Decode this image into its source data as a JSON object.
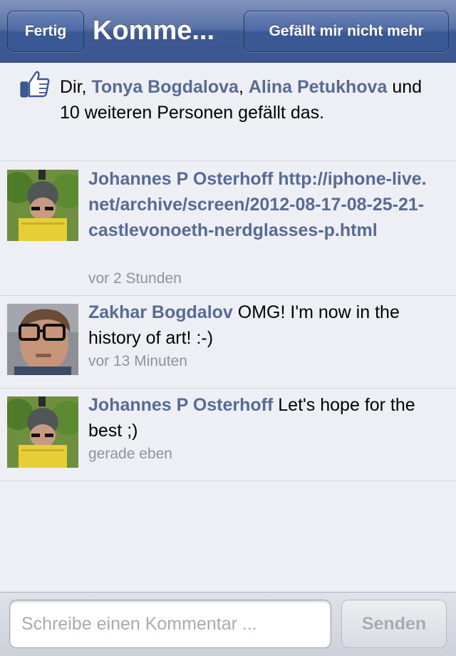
{
  "navbar": {
    "done_label": "Fertig",
    "title": "Komme...",
    "unlike_label": "Gefällt mir nicht mehr"
  },
  "likes": {
    "icon": "thumbs-up-icon",
    "prefix": "Dir, ",
    "person1": "Tonya Bogdalova",
    "sep": ", ",
    "person2": "Alina Petukhova",
    "suffix": " und 10 weiteren Personen gefällt das."
  },
  "comments": [
    {
      "author": "Johannes P Osterhoff",
      "text": "http://iphone-live.net/archive/screen/2012-08-17-08-25-21-castlevonoeth-nerdglasses-p.html",
      "time": "vor 2 Stunden",
      "is_link": true
    },
    {
      "author": "Zakhar Bogdalov",
      "text": "OMG! I'm now in the history of art! :-)",
      "time": "vor 13 Minuten",
      "is_link": false
    },
    {
      "author": "Johannes P Osterhoff",
      "text": "Let's hope for the best ;)",
      "time": "gerade eben",
      "is_link": false
    }
  ],
  "composer": {
    "placeholder": "Schreibe einen Kommentar ...",
    "value": "",
    "send_label": "Senden"
  },
  "colors": {
    "accent": "#576b95",
    "navbar": "#3a5590",
    "background": "#edeff4"
  }
}
